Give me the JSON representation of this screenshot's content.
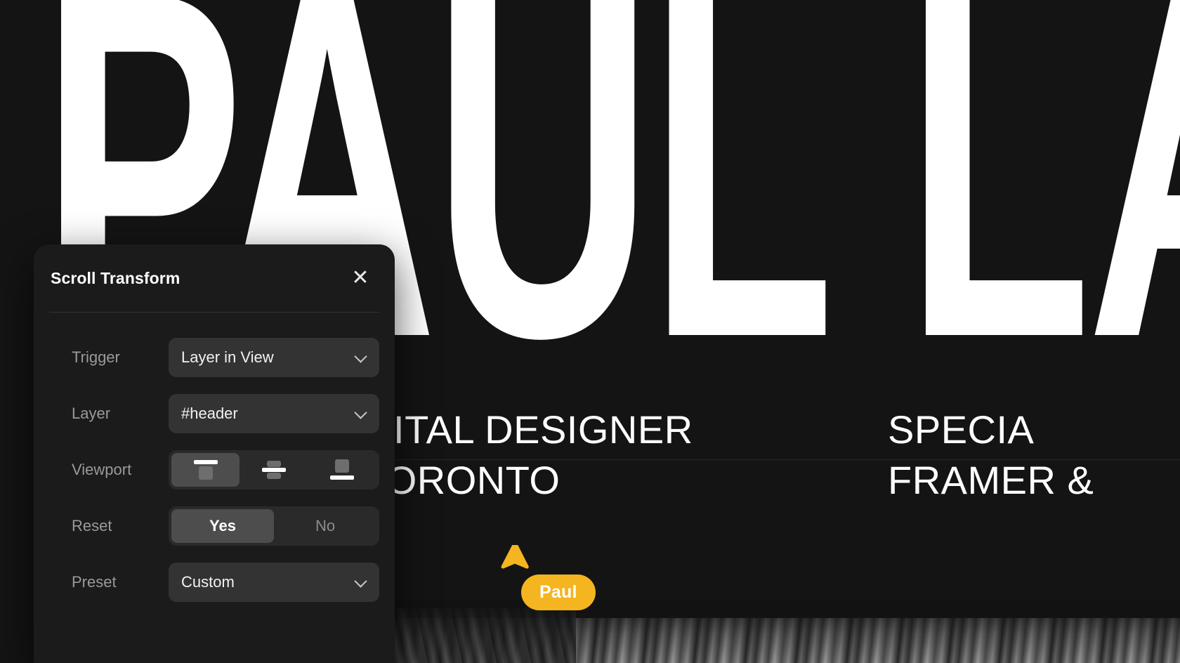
{
  "site": {
    "headline": "PAUL LAPI",
    "left_column": [
      "GITAL DESIGNER",
      "TORONTO"
    ],
    "right_column": [
      "SPECIA",
      "FRAMER &"
    ]
  },
  "panel": {
    "title": "Scroll Transform",
    "close_icon": "close-icon",
    "rows": {
      "trigger": {
        "label": "Trigger",
        "value": "Layer in View",
        "chevron_icon": "chevron-down-icon"
      },
      "layer": {
        "label": "Layer",
        "value": "#header",
        "chevron_icon": "chevron-down-icon"
      },
      "viewport": {
        "label": "Viewport",
        "options": [
          "viewport-top-icon",
          "viewport-middle-icon",
          "viewport-bottom-icon"
        ],
        "selected_index": 0
      },
      "reset": {
        "label": "Reset",
        "options": [
          "Yes",
          "No"
        ],
        "selected": "Yes"
      },
      "preset": {
        "label": "Preset",
        "value": "Custom",
        "chevron_icon": "chevron-down-icon"
      }
    }
  },
  "cursor": {
    "label": "Paul",
    "color": "#F5B520",
    "pointer_icon": "cursor-pointer-icon"
  },
  "colors": {
    "page_background": "#141414",
    "panel_background": "#1b1b1b",
    "control_background": "#333333",
    "segment_track": "#2a2a2a",
    "segment_active": "#4d4d4d",
    "label_text": "#9a9a9a",
    "value_text": "#f2f2f2",
    "accent": "#F5B520"
  }
}
